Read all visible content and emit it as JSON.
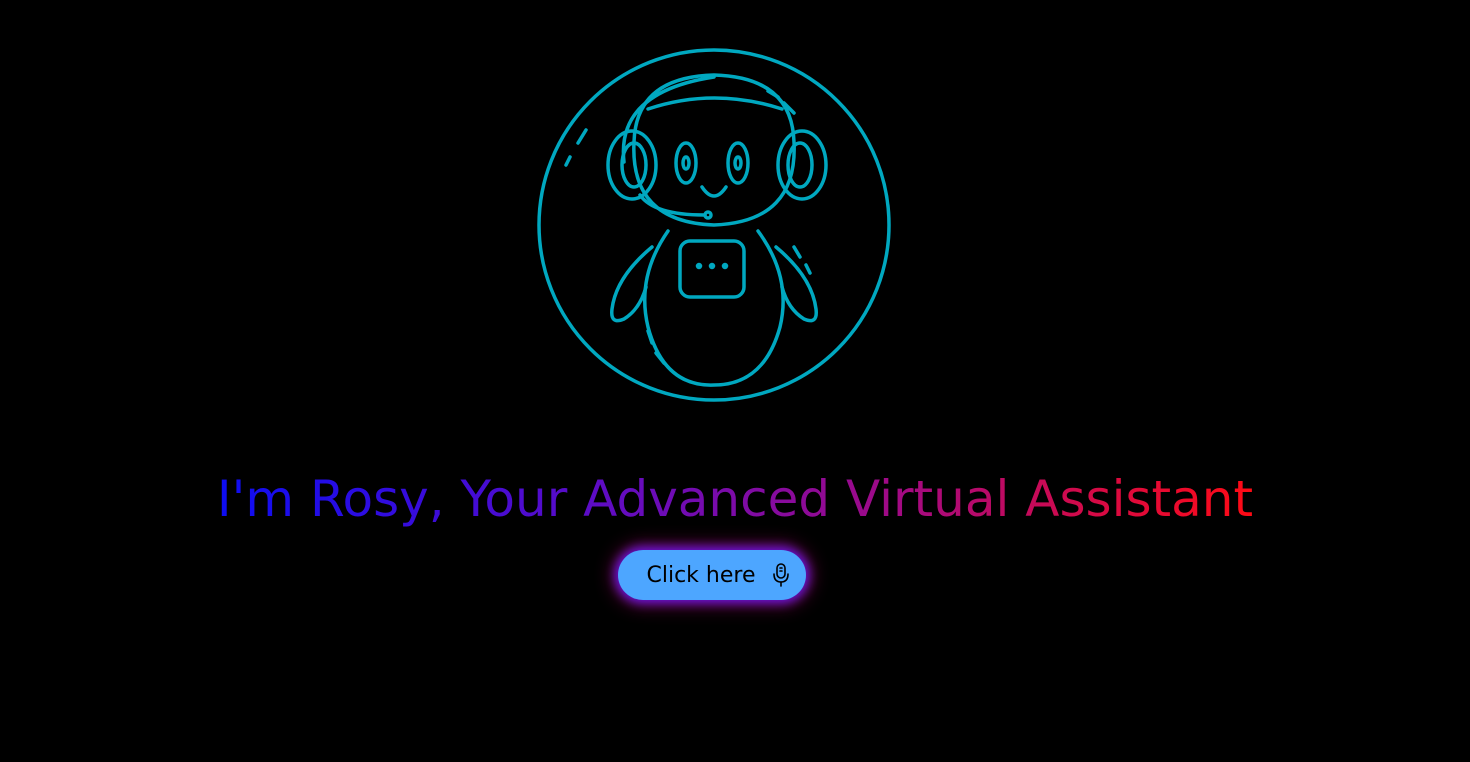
{
  "hero": {
    "headline": "I'm Rosy, Your Advanced Virtual Assistant",
    "avatar_icon": "robot-headset-icon"
  },
  "action": {
    "button_label": "Click here",
    "button_icon": "microphone-icon"
  },
  "colors": {
    "background": "#000000",
    "avatar_stroke": "#00a8c0",
    "headline_gradient_start": "#0d0df2",
    "headline_gradient_end": "#ff0a14",
    "button_fill": "#4da6ff",
    "button_glow": "#6e14ff"
  }
}
